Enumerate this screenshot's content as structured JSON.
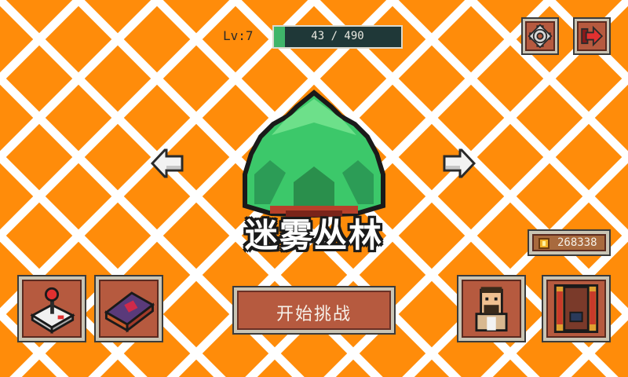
{
  "level": {
    "label": "Lv:7"
  },
  "xp": {
    "current": 43,
    "max": 490,
    "text": "43 / 490",
    "fraction": 0.088
  },
  "top_buttons": {
    "settings": "gear-icon",
    "exit": "exit-arrow-icon"
  },
  "stage": {
    "name": "迷雾丛林",
    "prev": "arrow-left-icon",
    "next": "arrow-right-icon"
  },
  "currency": {
    "coins": "268338",
    "icon": "coin-icon"
  },
  "start_button": {
    "label": "开始挑战"
  },
  "bottom_left": [
    {
      "icon": "joystick-icon"
    },
    {
      "icon": "spellbook-icon"
    }
  ],
  "bottom_right": [
    {
      "icon": "character-portrait-icon"
    },
    {
      "icon": "gate-icon"
    }
  ],
  "colors": {
    "background": "#FF8C0A",
    "grid_lines": "#FFFFFF",
    "button_fill": "#B65A3F",
    "button_frame": "#C9C4B4",
    "xp_fill": "#3FB56A",
    "xp_track": "#1F3838"
  }
}
